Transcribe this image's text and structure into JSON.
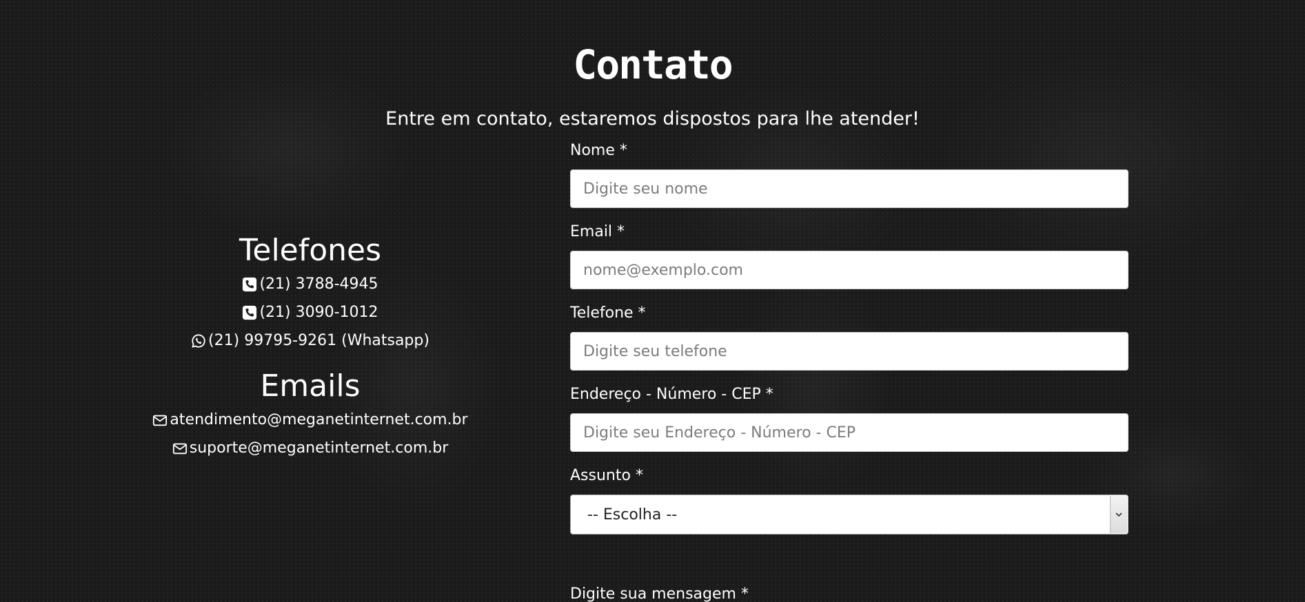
{
  "header": {
    "title": "Contato",
    "subtitle": "Entre em contato, estaremos dispostos para lhe atender!"
  },
  "phones": {
    "heading": "Telefones",
    "items": [
      {
        "icon": "phone-square-icon",
        "text": "(21) 3788-4945"
      },
      {
        "icon": "phone-square-icon",
        "text": "(21) 3090-1012"
      },
      {
        "icon": "whatsapp-icon",
        "text": "(21) 99795-9261 (Whatsapp)"
      }
    ]
  },
  "emails": {
    "heading": "Emails",
    "items": [
      {
        "icon": "envelope-icon",
        "text": "atendimento@meganetinternet.com.br"
      },
      {
        "icon": "envelope-icon",
        "text": "suporte@meganetinternet.com.br"
      }
    ]
  },
  "form": {
    "name": {
      "label": "Nome *",
      "placeholder": "Digite seu nome",
      "value": ""
    },
    "email": {
      "label": "Email *",
      "placeholder": "nome@exemplo.com",
      "value": ""
    },
    "phone": {
      "label": "Telefone *",
      "placeholder": "Digite seu telefone",
      "value": ""
    },
    "address": {
      "label": "Endereço - Número - CEP *",
      "placeholder": "Digite seu Endereço - Número - CEP",
      "value": ""
    },
    "subject": {
      "label": "Assunto *",
      "selected": "-- Escolha --"
    },
    "message": {
      "label": "Digite sua mensagem *"
    }
  },
  "colors": {
    "background": "#1b1b1b",
    "text": "#ffffff",
    "input_background": "#ffffff",
    "placeholder": "#7b7b7b"
  }
}
